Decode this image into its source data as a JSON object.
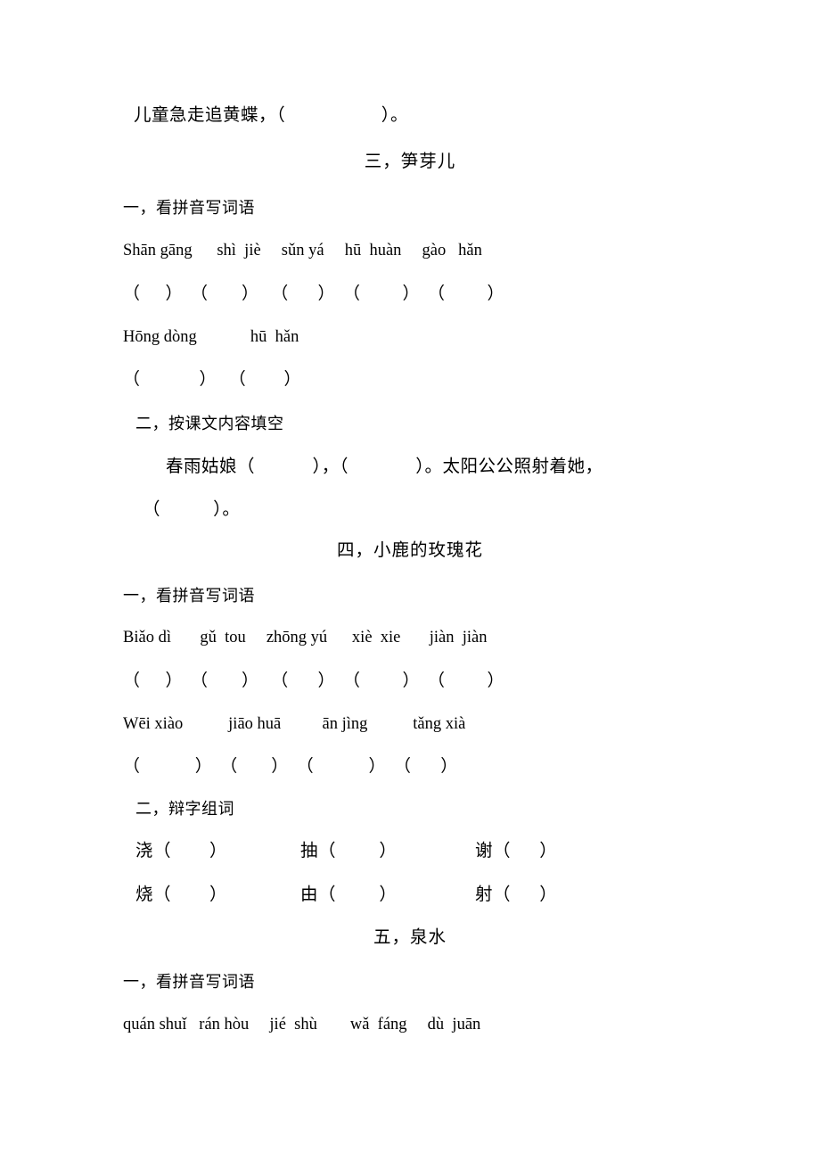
{
  "document": {
    "type": "chinese-language-worksheet",
    "lines": {
      "poem_line": "儿童急走追黄蝶，（                    ）。"
    }
  },
  "sections": [
    {
      "heading": "三，笋芽儿",
      "exercises": [
        {
          "label": "一，看拼音写词语",
          "pinyin_rows": [
            "Shān gāng      shì  jiè     sǔn yá     hū  huàn     gào   hǎn",
            "Hōng dòng             hū  hǎn"
          ],
          "blank_rows": [
            "（      ）  （        ）   （       ）  （          ）  （          ）",
            "（              ）   （         ）"
          ]
        },
        {
          "label": "二，按课文内容填空",
          "content_lines": [
            "春雨姑娘（            ），（              ）。太阳公公照射着她，",
            "（           ）。"
          ]
        }
      ]
    },
    {
      "heading": "四，小鹿的玫瑰花",
      "exercises": [
        {
          "label": "一，看拼音写词语",
          "pinyin_rows": [
            "Biǎo dì       gǔ  tou     zhōng yú      xiè  xie       jiàn  jiàn",
            "Wēi xiào           jiāo huā          ān jìng           tǎng xià"
          ],
          "blank_rows": [
            "（      ）  （        ）   （       ）  （          ）  （          ）",
            "（             ）  （        ）  （             ）  （       ）"
          ]
        },
        {
          "label": "二，辩字组词",
          "char_pairs": [
            {
              "top": "浇（        ）",
              "bottom": "烧（        ）"
            },
            {
              "top": "抽（         ）",
              "bottom": "由（         ）"
            },
            {
              "top": "谢（      ）",
              "bottom": "射（      ）"
            }
          ]
        }
      ]
    },
    {
      "heading": "五，泉水",
      "exercises": [
        {
          "label": "一，看拼音写词语",
          "pinyin_rows": [
            "quán shuǐ   rán hòu     jié  shù        wǎ  fáng     dù  juān"
          ]
        }
      ]
    }
  ],
  "text": {
    "poem_line": "儿童急走追黄蝶，（                    ）。",
    "s3_heading": "三，笋芽儿",
    "s3_ex1_label": "一，看拼音写词语",
    "s3_ex1_py1": "Shān gāng      shì  jiè     sǔn yá     hū  huàn     gào   hǎn",
    "s3_ex1_bl1": "（      ）  （        ）   （       ）  （          ）  （          ）",
    "s3_ex1_py2": "Hōng dòng             hū  hǎn",
    "s3_ex1_bl2": "（              ）   （         ）",
    "s3_ex2_label": "二，按课文内容填空",
    "s3_ex2_line1": "春雨姑娘（            ），（              ）。太阳公公照射着她，",
    "s3_ex2_line2": "（           ）。",
    "s4_heading": "四，小鹿的玫瑰花",
    "s4_ex1_label": "一，看拼音写词语",
    "s4_ex1_py1": "Biǎo dì       gǔ  tou     zhōng yú      xiè  xie       jiàn  jiàn",
    "s4_ex1_bl1": "（      ）  （        ）   （       ）  （          ）  （          ）",
    "s4_ex1_py2": "Wēi xiào           jiāo huā          ān jìng           tǎng xià",
    "s4_ex1_bl2": "（             ）  （        ）  （             ）  （       ）",
    "s4_ex2_label": "二，辩字组词",
    "s4_ex2_r1c1": "浇（        ）",
    "s4_ex2_r1c2": "抽（         ）",
    "s4_ex2_r1c3": "谢（      ）",
    "s4_ex2_r2c1": "烧（        ）",
    "s4_ex2_r2c2": "由（         ）",
    "s4_ex2_r2c3": "射（      ）",
    "s5_heading": "五，泉水",
    "s5_ex1_label": "一，看拼音写词语",
    "s5_ex1_py1": "quán shuǐ   rán hòu     jié  shù        wǎ  fáng     dù  juān"
  }
}
